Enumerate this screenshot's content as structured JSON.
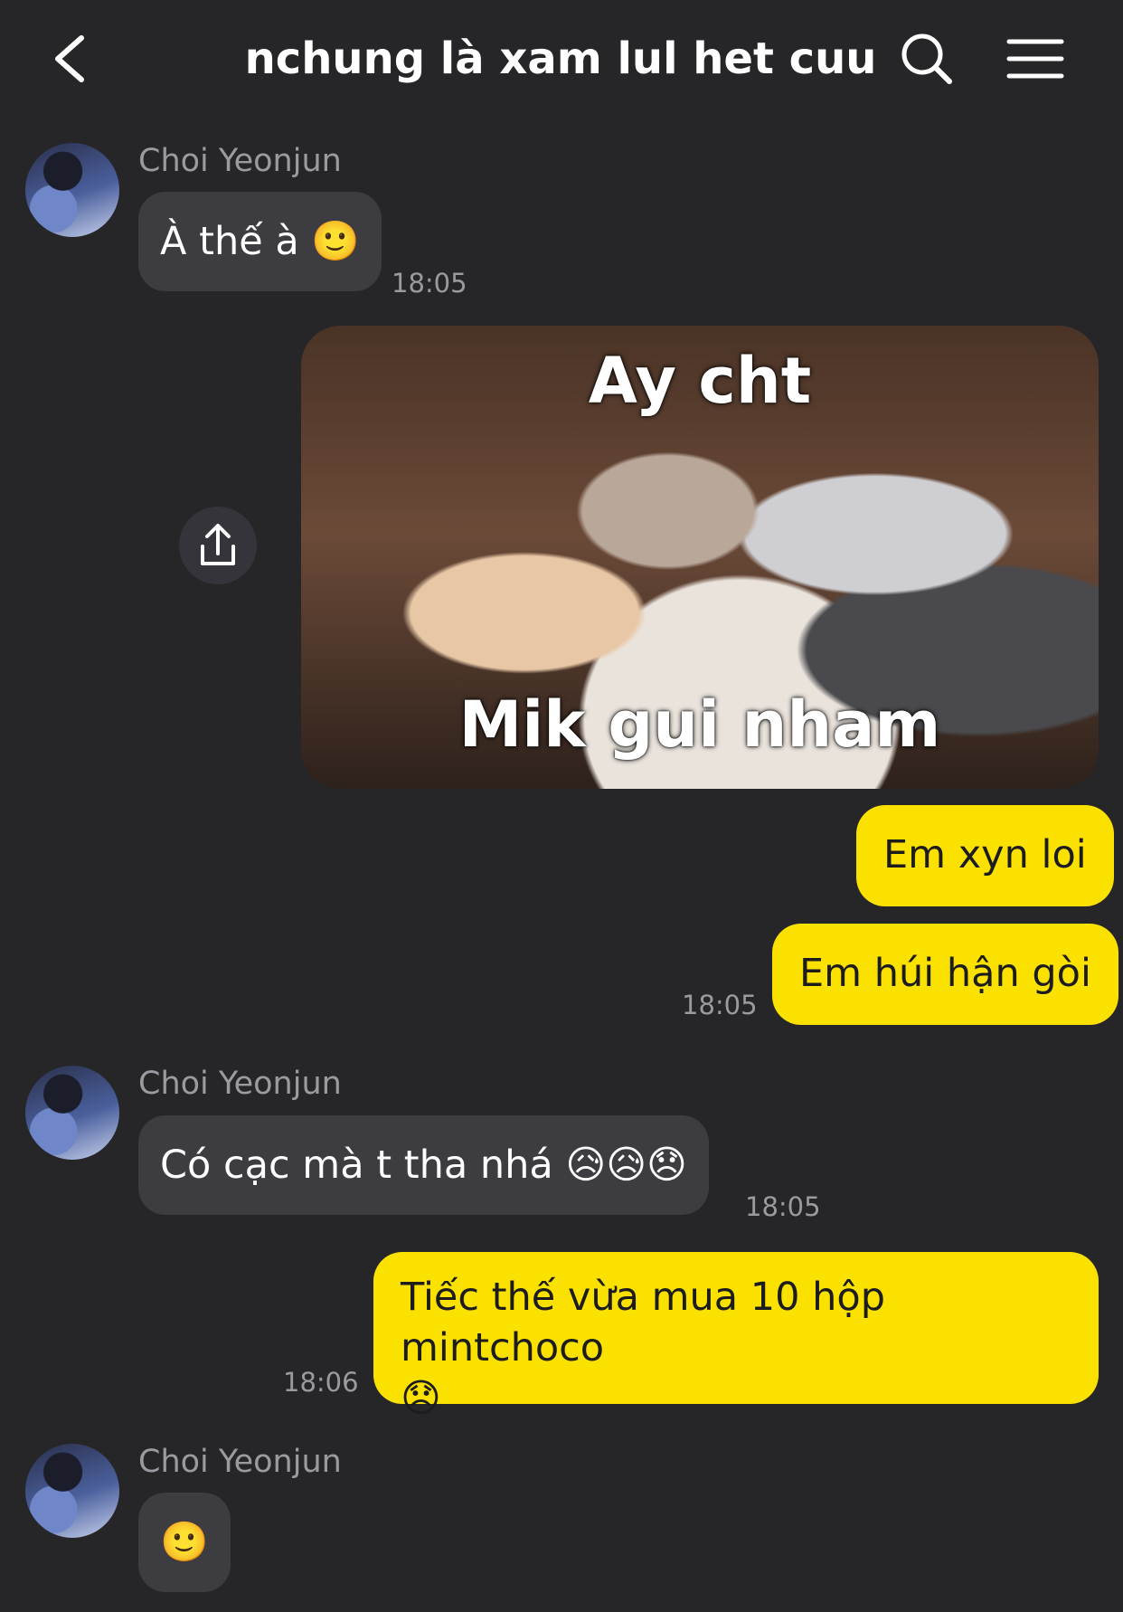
{
  "header": {
    "title": "nchung là xam lul het cuu"
  },
  "icons": {
    "back": "chevron-left-icon",
    "search": "search-icon",
    "menu": "hamburger-menu-icon",
    "share": "share-icon"
  },
  "colors": {
    "background": "#262629",
    "incoming_bubble": "#3c3c41",
    "outgoing_bubble": "#fae100"
  },
  "messages": [
    {
      "sender": "Choi Yeonjun",
      "text": "À thế à 🙂",
      "time": "18:05"
    },
    {
      "image_caption_top": "Ay cht",
      "image_caption_bottom": "Mik gui nham"
    },
    {
      "text": "Em xyn loi"
    },
    {
      "text": "Em húi hận gòi",
      "time": "18:05"
    },
    {
      "sender": "Choi Yeonjun",
      "text": "Có cạc mà t tha nhá 😥😥😞",
      "time": "18:05"
    },
    {
      "text_line1": "Tiếc thế vừa mua 10 hộp mintchoco",
      "text_line2": "😞",
      "time": "18:06"
    },
    {
      "sender": "Choi Yeonjun",
      "text": "🙂"
    }
  ]
}
